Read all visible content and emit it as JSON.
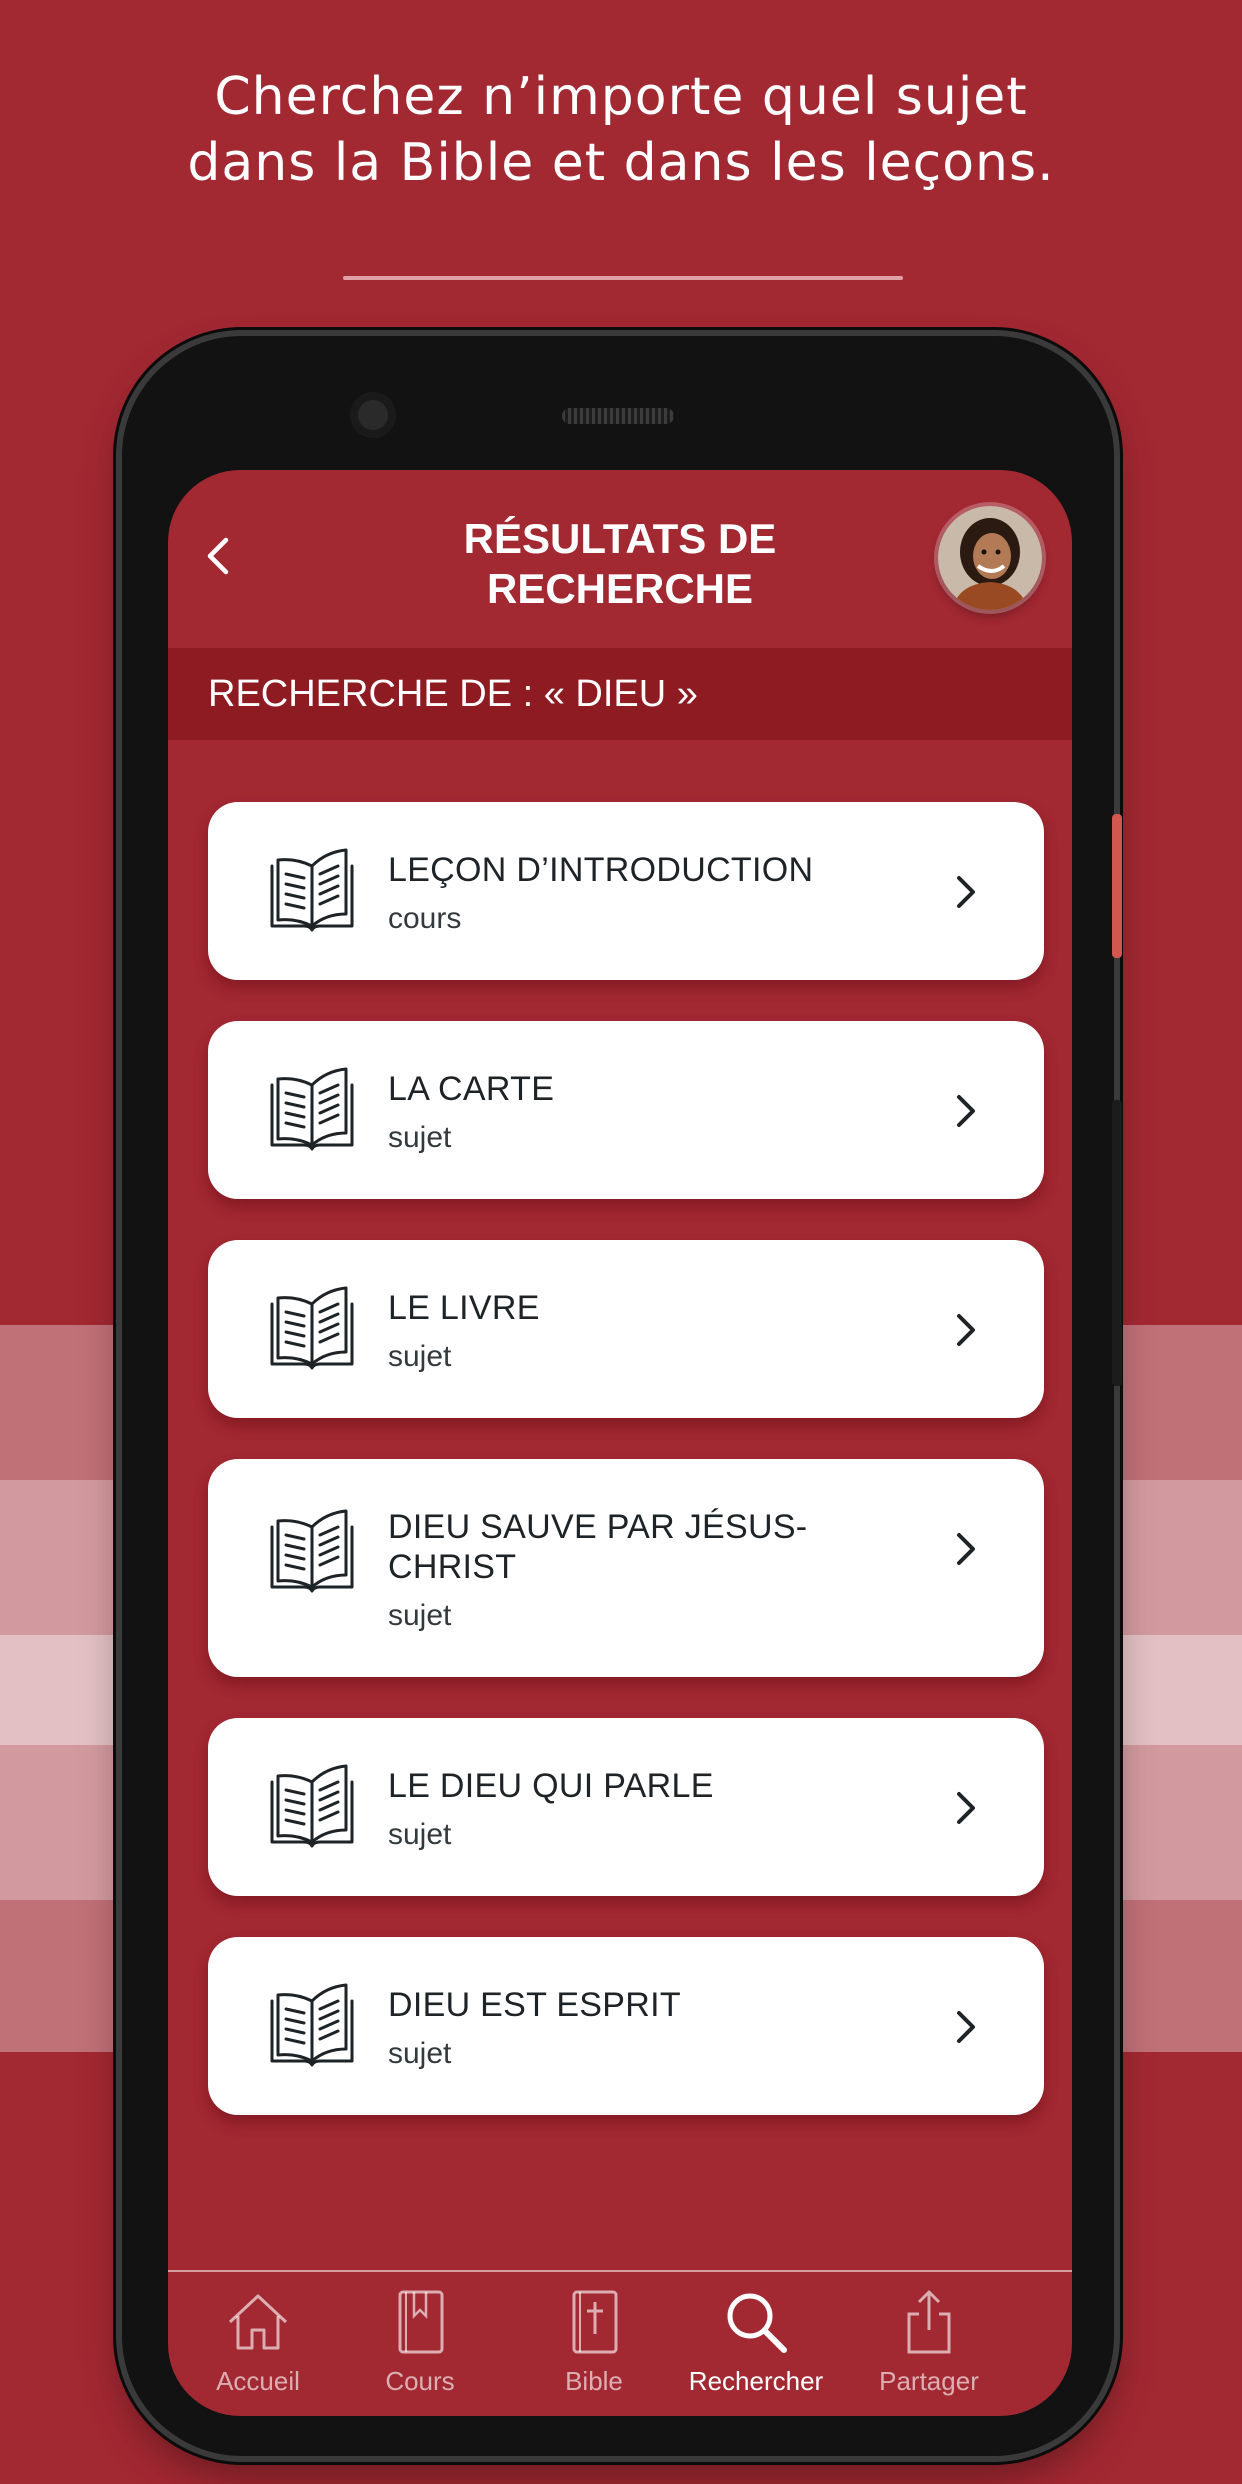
{
  "promo": {
    "headline_line1": "Cherchez n’importe quel sujet",
    "headline_line2": "dans la Bible et dans les leçons."
  },
  "colors": {
    "background": "#a22832",
    "search_bar": "#8e1a22",
    "card": "#ffffff",
    "text_dark": "#1d2326",
    "accent_button": "#d2584f"
  },
  "header": {
    "title_line1": "RÉSULTATS DE",
    "title_line2": "RECHERCHE",
    "back_icon": "chevron-left-icon",
    "avatar_icon": "user-avatar-photo"
  },
  "search": {
    "label": "RECHERCHE DE : « DIEU »"
  },
  "results": [
    {
      "title": "LEÇON D’INTRODUCTION",
      "kind": "cours",
      "icon": "open-book-icon"
    },
    {
      "title": "LA CARTE",
      "kind": "sujet",
      "icon": "open-book-icon"
    },
    {
      "title": "LE LIVRE",
      "kind": "sujet",
      "icon": "open-book-icon"
    },
    {
      "title": "DIEU SAUVE PAR JÉSUS-CHRIST",
      "kind": "sujet",
      "icon": "open-book-icon"
    },
    {
      "title": "LE DIEU QUI PARLE",
      "kind": "sujet",
      "icon": "open-book-icon"
    },
    {
      "title": "DIEU EST ESPRIT",
      "kind": "sujet",
      "icon": "open-book-icon"
    }
  ],
  "tabbar": {
    "active": "Rechercher",
    "items": [
      {
        "label": "Accueil",
        "icon": "home-icon"
      },
      {
        "label": "Cours",
        "icon": "bookmark-book-icon"
      },
      {
        "label": "Bible",
        "icon": "bible-cross-icon"
      },
      {
        "label": "Rechercher",
        "icon": "search-icon"
      },
      {
        "label": "Partager",
        "icon": "share-icon"
      }
    ]
  }
}
